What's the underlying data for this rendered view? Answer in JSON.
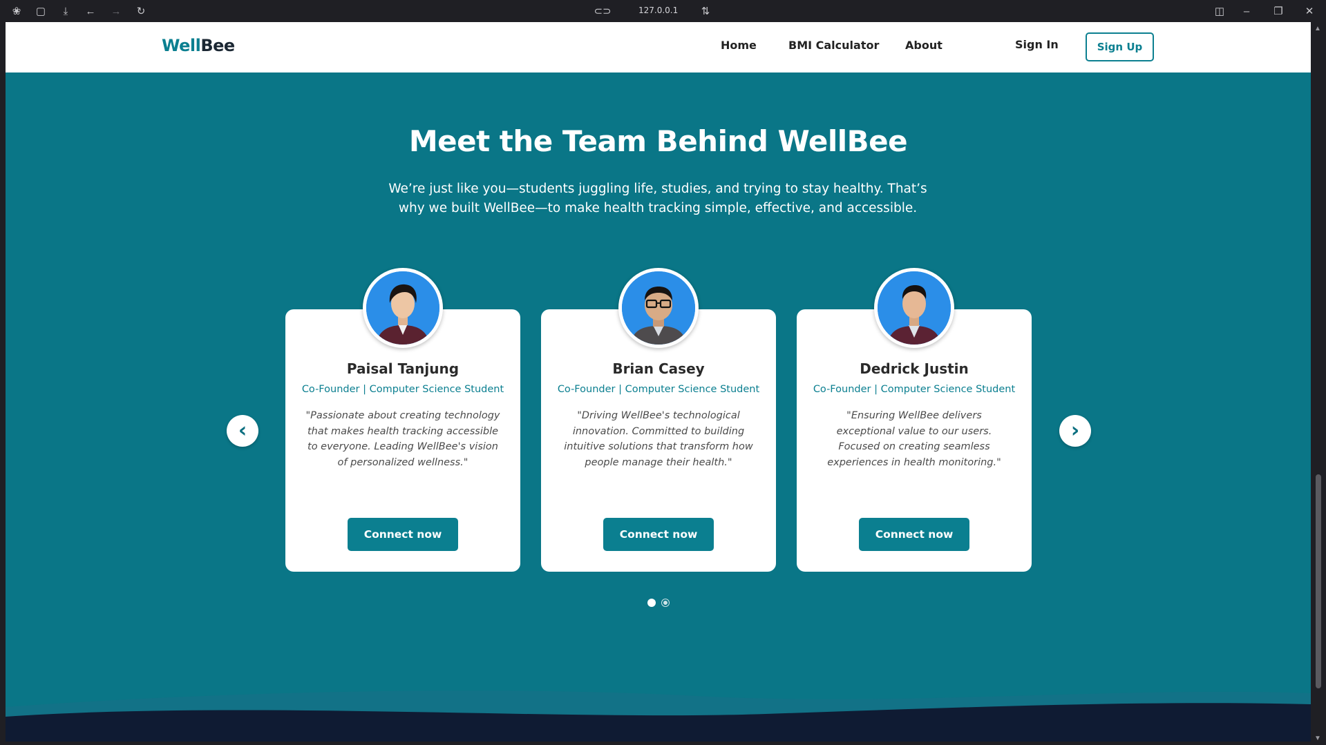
{
  "browser": {
    "address": "127.0.0.1",
    "icons": [
      "app-menu-icon",
      "sidebar-icon",
      "download-icon",
      "back-icon",
      "forward-icon",
      "reload-icon",
      "link-icon",
      "tune-icon",
      "split-view-icon",
      "minimize-icon",
      "maximize-icon",
      "close-icon"
    ]
  },
  "nav": {
    "logo_part1": "Well",
    "logo_part2": "Bee",
    "links": [
      {
        "label": "Home"
      },
      {
        "label": "BMI Calculator"
      },
      {
        "label": "About"
      }
    ],
    "sign_in": "Sign In",
    "sign_up": "Sign Up"
  },
  "hero": {
    "title": "Meet the Team Behind WellBee",
    "subtitle": "We’re just like you—students juggling life, studies, and trying to stay healthy. That’s why we built WellBee—to make health tracking simple, effective, and accessible."
  },
  "team": [
    {
      "name": "Paisal Tanjung",
      "role": "Co-Founder | Computer Science Student",
      "quote": "\"Passionate about creating technology that makes health tracking accessible to everyone. Leading WellBee's vision of personalized wellness.\"",
      "button": "Connect now"
    },
    {
      "name": "Brian Casey",
      "role": "Co-Founder | Computer Science Student",
      "quote": "\"Driving WellBee's technological innovation. Committed to building intuitive solutions that transform how people manage their health.\"",
      "button": "Connect now"
    },
    {
      "name": "Dedrick Justin",
      "role": "Co-Founder | Computer Science Student",
      "quote": "\"Ensuring WellBee delivers exceptional value to our users. Focused on creating seamless experiences in health monitoring.\"",
      "button": "Connect now"
    }
  ],
  "carousel": {
    "prev_glyph": "‹",
    "next_glyph": "›",
    "page_count": 2,
    "active_page": 1
  },
  "colors": {
    "brand": "#0b7f90",
    "background": "#0a7687",
    "footer_wave": "#0f1b33"
  }
}
